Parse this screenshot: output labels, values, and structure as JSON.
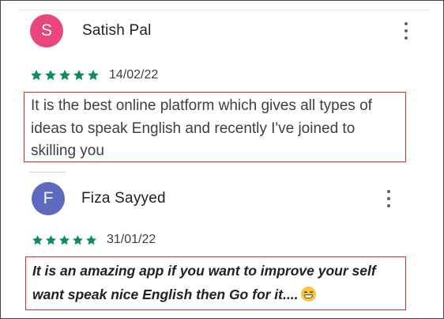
{
  "colors": {
    "star": "#0d8a5f",
    "avatar_s": "#e8467c",
    "avatar_f": "#5c6bc0",
    "highlight_box": "#d32f2f"
  },
  "reviews": [
    {
      "avatar_letter": "S",
      "name": "Satish Pal",
      "rating": 5,
      "date": "14/02/22",
      "text": "It is the best online platform which gives all types of ideas to speak English and recently I've joined to skilling you",
      "menu_icon": "more-vert-icon"
    },
    {
      "avatar_letter": "F",
      "name": "Fiza Sayyed",
      "rating": 5,
      "date": "31/01/22",
      "text": "It is an amazing app if you want to improve your self want speak nice English then Go for it....",
      "emoji": "grinning-face-icon",
      "menu_icon": "more-vert-icon"
    }
  ]
}
